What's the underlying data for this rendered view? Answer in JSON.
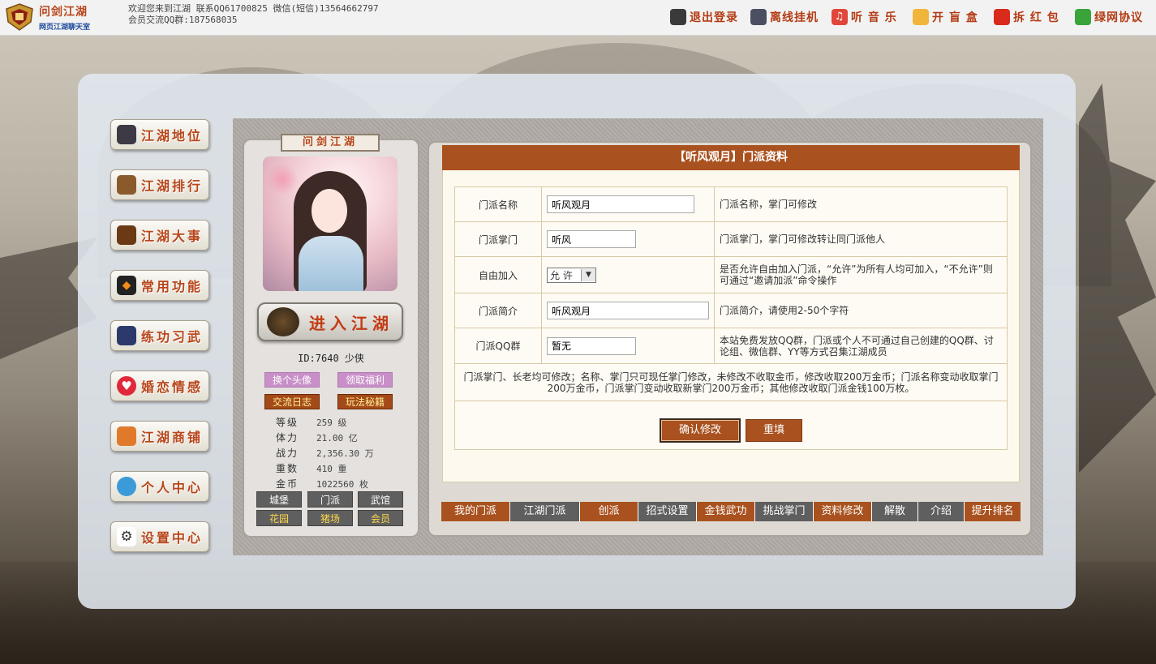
{
  "header": {
    "logo_title": "问剑江湖",
    "logo_subtitle": "网页江湖聊天室",
    "welcome_line1": "欢迎您来到江湖 联系QQ61700825 微信(短信)13564662797",
    "welcome_line2": "会员交流QQ群:187568035",
    "nav": [
      {
        "label": "退出登录",
        "icon": "logout-icon"
      },
      {
        "label": "离线挂机",
        "icon": "offline-icon"
      },
      {
        "label": "听 音 乐",
        "icon": "music-icon"
      },
      {
        "label": "开 盲 盒",
        "icon": "blindbox-icon"
      },
      {
        "label": "拆 红 包",
        "icon": "redpacket-icon"
      },
      {
        "label": "绿网协议",
        "icon": "green-protocol-icon"
      }
    ]
  },
  "sidebar": {
    "items": [
      {
        "label": "江湖地位"
      },
      {
        "label": "江湖排行"
      },
      {
        "label": "江湖大事"
      },
      {
        "label": "常用功能"
      },
      {
        "label": "练功习武"
      },
      {
        "label": "婚恋情感"
      },
      {
        "label": "江湖商铺"
      },
      {
        "label": "个人中心"
      },
      {
        "label": "设置中心"
      }
    ]
  },
  "profile": {
    "card_title": "问剑江湖",
    "enter_label": "进入江湖",
    "enter_icon_text": "问剑江湖",
    "id_line": "ID:7640  少侠",
    "buttons": [
      "换个头像",
      "领取福利",
      "交流日志",
      "玩法秘籍"
    ],
    "stats": [
      {
        "key": "等级",
        "value": "259 级"
      },
      {
        "key": "体力",
        "value": "21.00 亿"
      },
      {
        "key": "战力",
        "value": "2,356.30 万"
      },
      {
        "key": "重数",
        "value": "410 重"
      },
      {
        "key": "金币",
        "value": "1022560 枚"
      }
    ],
    "grid": [
      "城堡",
      "门派",
      "武馆",
      "花园",
      "猪场",
      "会员"
    ]
  },
  "faction": {
    "header": "【听风观月】门派资料",
    "rows": [
      {
        "label": "门派名称",
        "value": "听风观月",
        "desc": "门派名称，掌门可修改"
      },
      {
        "label": "门派掌门",
        "value": "听风",
        "desc": "门派掌门，掌门可修改转让同门派他人"
      },
      {
        "label": "自由加入",
        "value": "允 许",
        "desc": "是否允许自由加入门派，“允许”为所有人均可加入，“不允许”则可通过“邀请加派”命令操作"
      },
      {
        "label": "门派简介",
        "value": "听风观月",
        "desc": "门派简介，请使用2-50个字符"
      },
      {
        "label": "门派QQ群",
        "value": "暂无",
        "desc": "本站免费发放QQ群，门派或个人不可通过自己创建的QQ群、讨论组、微信群、YY等方式召集江湖成员"
      }
    ],
    "note": "门派掌门、长老均可修改；名称、掌门只可现任掌门修改，未修改不收取金币，修改收取200万金币；门派名称变动收取掌门200万金币，门派掌门变动收取新掌门200万金币；其他修改收取门派金钱100万枚。",
    "confirm_label": "确认修改",
    "reset_label": "重填"
  },
  "tabs": [
    "我的门派",
    "江湖门派",
    "创派",
    "招式设置",
    "金钱武功",
    "挑战掌门",
    "资料修改",
    "解散",
    "介绍",
    "提升排名"
  ],
  "colors": {
    "accent": "#a9521f",
    "gray": "#5f5f5f",
    "title": "#b8461a"
  }
}
